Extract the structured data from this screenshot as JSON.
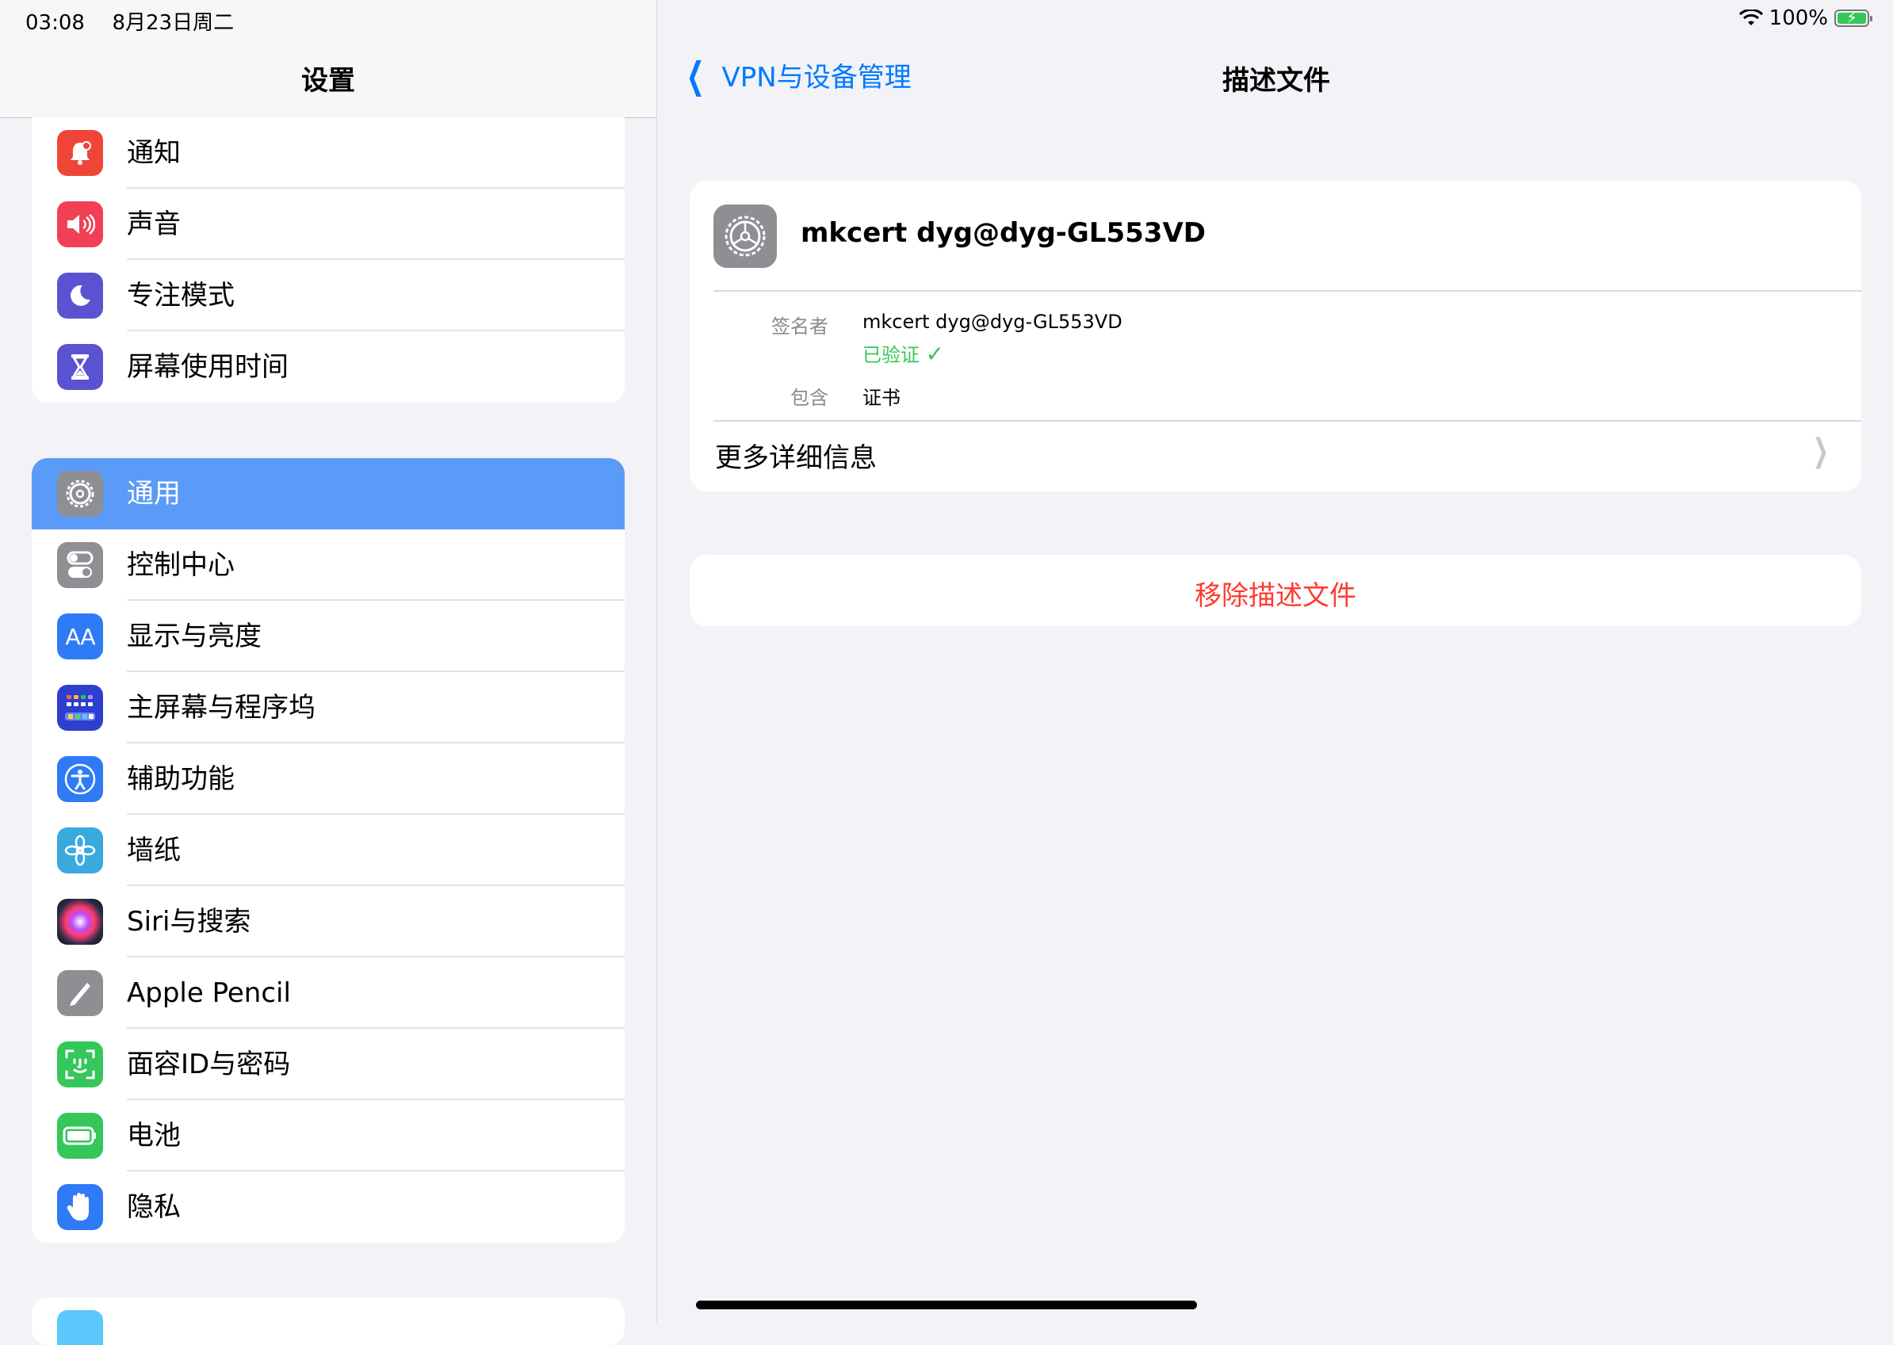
{
  "status_bar": {
    "time": "03:08",
    "date": "8月23日周二",
    "battery_text": "100%"
  },
  "sidebar": {
    "title": "设置",
    "groups": [
      {
        "items": [
          {
            "label": "通知",
            "icon": "bell-icon",
            "color": "#ef4538"
          },
          {
            "label": "声音",
            "icon": "speaker-icon",
            "color": "#f14056"
          },
          {
            "label": "专注模式",
            "icon": "moon-icon",
            "color": "#5b52d2"
          },
          {
            "label": "屏幕使用时间",
            "icon": "hourglass-icon",
            "color": "#5b52d2"
          }
        ]
      },
      {
        "items": [
          {
            "label": "通用",
            "icon": "gear-icon",
            "color": "#8e8e93",
            "selected": true
          },
          {
            "label": "控制中心",
            "icon": "toggles-icon",
            "color": "#8e8e93"
          },
          {
            "label": "显示与亮度",
            "icon": "text-size-icon",
            "color": "#2f7bf6"
          },
          {
            "label": "主屏幕与程序坞",
            "icon": "app-grid-icon",
            "color": "#2c3fcf"
          },
          {
            "label": "辅助功能",
            "icon": "accessibility-icon",
            "color": "#2f7bf6"
          },
          {
            "label": "墙纸",
            "icon": "flower-icon",
            "color": "#39a9de"
          },
          {
            "label": "Siri与搜索",
            "icon": "siri-icon",
            "color": "#1c1c28"
          },
          {
            "label": "Apple Pencil",
            "icon": "pencil-icon",
            "color": "#8e8e93"
          },
          {
            "label": "面容ID与密码",
            "icon": "face-id-icon",
            "color": "#34c759"
          },
          {
            "label": "电池",
            "icon": "battery-icon",
            "color": "#34c759"
          },
          {
            "label": "隐私",
            "icon": "hand-icon",
            "color": "#2f7bf6"
          }
        ]
      }
    ]
  },
  "detail": {
    "back_label": "VPN与设备管理",
    "title": "描述文件",
    "profile": {
      "name": "mkcert dyg@dyg-GL553VD",
      "signer_key": "签名者",
      "signer_value": "mkcert dyg@dyg-GL553VD",
      "verified_label": "已验证",
      "contains_key": "包含",
      "contains_value": "证书",
      "more_info_label": "更多详细信息"
    },
    "remove_label": "移除描述文件"
  },
  "colors": {
    "accent": "#007aff",
    "selected_row": "#5b9bf8",
    "verified": "#34c759",
    "destructive": "#ff3b30"
  }
}
